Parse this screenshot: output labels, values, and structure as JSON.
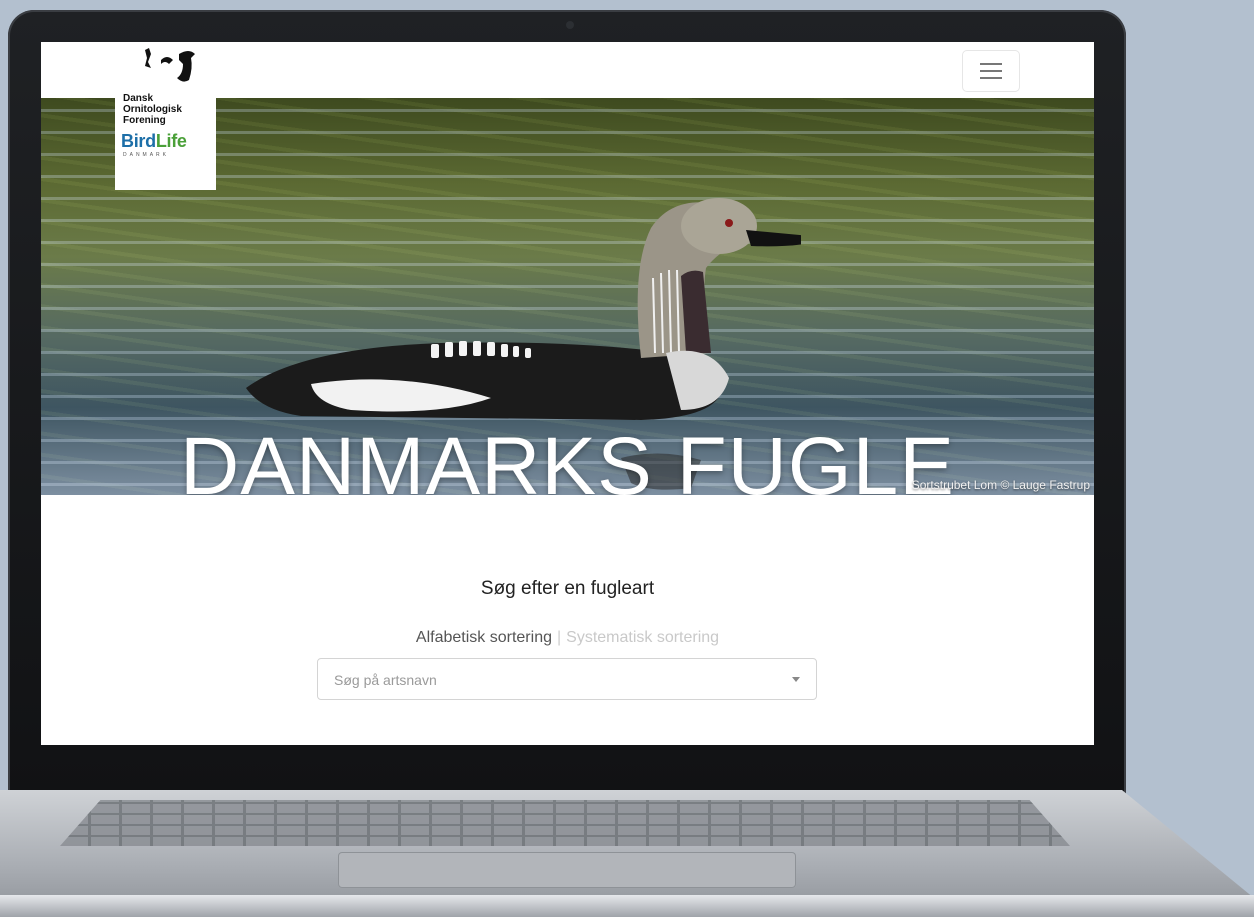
{
  "logo": {
    "lines": [
      "Dansk",
      "Ornitologisk",
      "Forening"
    ],
    "birdlife_bird": "Bird",
    "birdlife_life": "Life",
    "birdlife_country": "DANMARK"
  },
  "navbar": {
    "menu_icon": "hamburger-icon"
  },
  "hero": {
    "title": "DANMARKS FUGLE",
    "credit": "Sortstrubet Lom © Lauge Fastrup"
  },
  "search": {
    "heading": "Søg efter en fugleart",
    "sort_alphabetical": "Alfabetisk sortering",
    "sort_separator": "|",
    "sort_systematic": "Systematisk sortering",
    "placeholder": "Søg på artsnavn"
  }
}
